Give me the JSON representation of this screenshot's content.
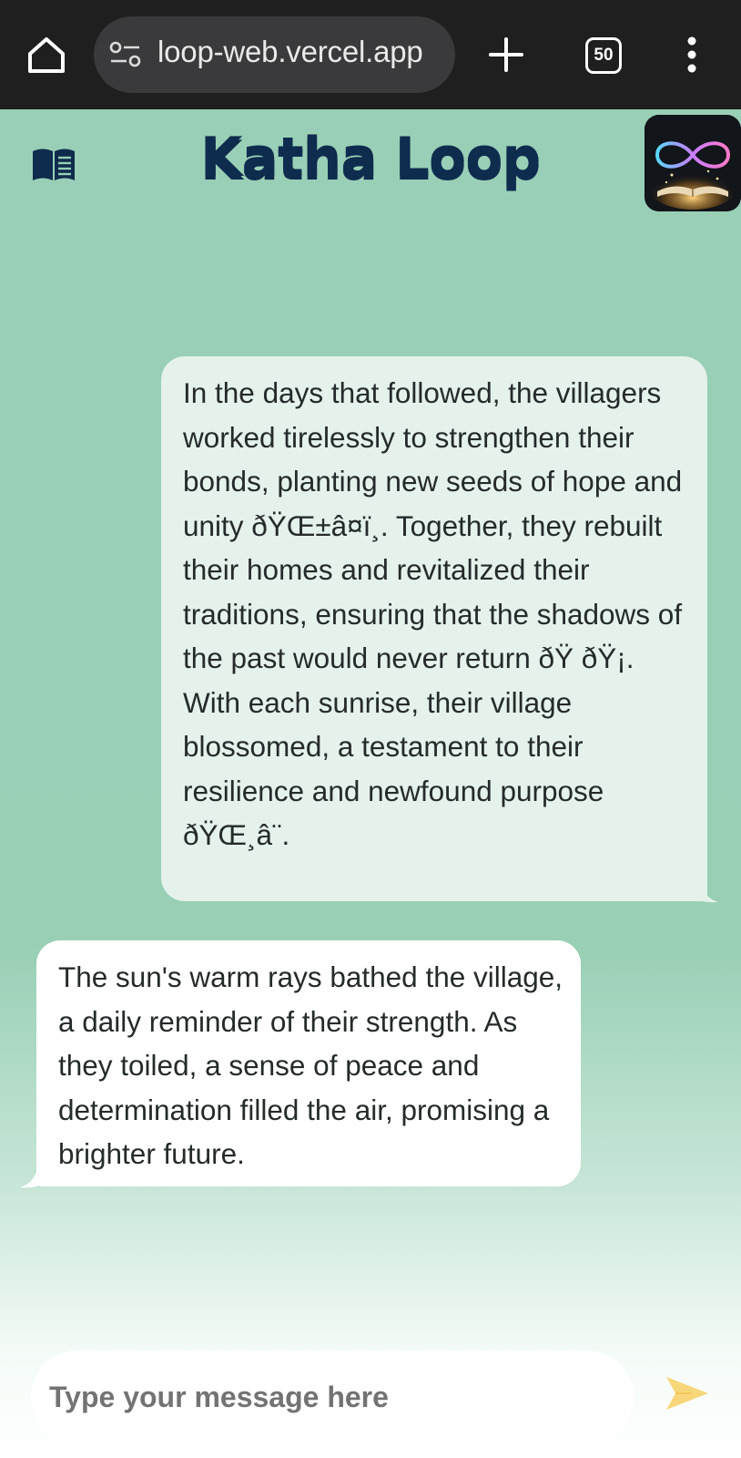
{
  "browser": {
    "url": "loop-web.vercel.app",
    "tab_count": "50"
  },
  "app": {
    "title": "Katha Loop"
  },
  "messages": [
    {
      "role": "user",
      "text": "In the days that followed, the villagers worked tirelessly to strengthen their bonds, planting new seeds of hope and unity ðŸŒ±â¤ï¸. Together, they rebuilt their homes and revitalized their traditions, ensuring that the shadows of the past would never return ðŸ ðŸ¡. With each sunrise, their village blossomed, a testament to their resilience and newfound purpose ðŸŒ¸â¨."
    },
    {
      "role": "bot",
      "text": "The sun's warm rays bathed the village, a daily reminder of their strength. As they toiled, a sense of peace and determination filled the air, promising a brighter future."
    }
  ],
  "composer": {
    "placeholder": "Type your message here"
  },
  "icons": {
    "home": "home-icon",
    "site_settings": "tune-icon",
    "new_tab": "plus-icon",
    "menu": "more-vert-icon",
    "book": "book-icon",
    "logo": "infinity-book-logo",
    "send": "send-icon"
  },
  "colors": {
    "app_background": "#98cfb5",
    "title": "#0e2c4d",
    "user_bubble": "#e4f2eb",
    "bot_bubble": "#ffffff",
    "send_icon": "#f8d77a"
  }
}
